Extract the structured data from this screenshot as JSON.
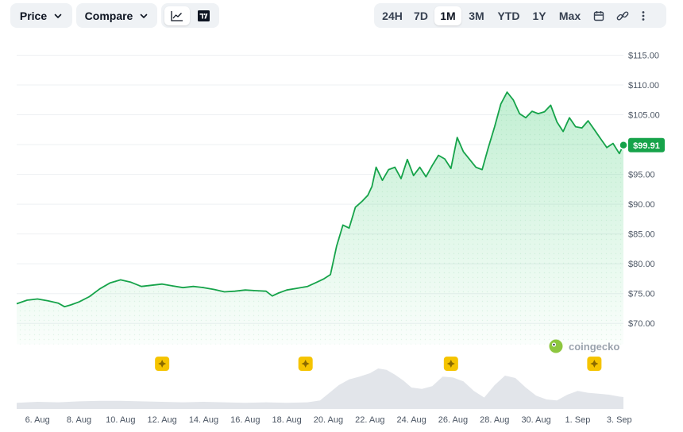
{
  "toolbar": {
    "price_label": "Price",
    "compare_label": "Compare",
    "ranges": [
      "24H",
      "7D",
      "1M",
      "3M",
      "YTD",
      "1Y",
      "Max"
    ],
    "active_range": "1M"
  },
  "watermark": "coingecko",
  "colors": {
    "line": "#16a34a",
    "area_top": "#22c55e",
    "badge": "#16a34a",
    "volume": "#e2e5ea",
    "event_marker": "#f5c400",
    "grid": "#eef0f3"
  },
  "chart_data": {
    "type": "line",
    "title": "",
    "xlabel": "",
    "ylabel": "",
    "ylim": [
      66.5,
      116
    ],
    "x_tick_labels": [
      "6. Aug",
      "8. Aug",
      "10. Aug",
      "12. Aug",
      "14. Aug",
      "16. Aug",
      "18. Aug",
      "20. Aug",
      "22. Aug",
      "24. Aug",
      "26. Aug",
      "28. Aug",
      "30. Aug",
      "1. Sep",
      "3. Sep"
    ],
    "x_tick_days": [
      6,
      8,
      10,
      12,
      14,
      16,
      18,
      20,
      22,
      24,
      26,
      28,
      30,
      32,
      34
    ],
    "y_tick_values": [
      70,
      75,
      80,
      85,
      90,
      95,
      100,
      105,
      110,
      115
    ],
    "y_tick_labels": [
      "$70.00",
      "$75.00",
      "$80.00",
      "$85.00",
      "$90.00",
      "$95.00",
      "$100.00",
      "$105.00",
      "$110.00",
      "$115.00"
    ],
    "current_price_label": "$99.91",
    "current_price": 99.91,
    "price_series": {
      "x_day": [
        5.0,
        5.5,
        6.0,
        6.5,
        7.0,
        7.3,
        7.6,
        8.0,
        8.5,
        9.0,
        9.5,
        10.0,
        10.5,
        11.0,
        11.5,
        12.0,
        12.5,
        13.0,
        13.5,
        14.0,
        14.5,
        15.0,
        15.5,
        16.0,
        16.5,
        17.0,
        17.3,
        17.6,
        18.0,
        18.5,
        19.0,
        19.5,
        19.8,
        20.1,
        20.4,
        20.7,
        21.0,
        21.3,
        21.6,
        21.9,
        22.1,
        22.3,
        22.6,
        22.9,
        23.2,
        23.5,
        23.8,
        24.1,
        24.4,
        24.7,
        25.0,
        25.3,
        25.6,
        25.9,
        26.2,
        26.5,
        26.8,
        27.1,
        27.4,
        27.7,
        28.0,
        28.3,
        28.6,
        28.9,
        29.2,
        29.5,
        29.8,
        30.1,
        30.4,
        30.7,
        31.0,
        31.3,
        31.6,
        31.9,
        32.2,
        32.5,
        32.8,
        33.1,
        33.4,
        33.7,
        34.0,
        34.2
      ],
      "price": [
        73.3,
        73.9,
        74.1,
        73.8,
        73.4,
        72.8,
        73.1,
        73.6,
        74.5,
        75.8,
        76.8,
        77.3,
        76.9,
        76.2,
        76.4,
        76.6,
        76.3,
        76.0,
        76.2,
        76.0,
        75.7,
        75.3,
        75.4,
        75.6,
        75.5,
        75.4,
        74.6,
        75.1,
        75.6,
        75.9,
        76.2,
        77.0,
        77.5,
        78.2,
        83.0,
        86.5,
        86.0,
        89.5,
        90.4,
        91.5,
        93.0,
        96.2,
        94.0,
        95.8,
        96.2,
        94.3,
        97.5,
        94.8,
        96.2,
        94.6,
        96.5,
        98.2,
        97.6,
        96.0,
        101.2,
        98.8,
        97.5,
        96.2,
        95.8,
        99.5,
        103.0,
        106.8,
        108.8,
        107.5,
        105.2,
        104.5,
        105.6,
        105.2,
        105.5,
        106.6,
        103.8,
        102.2,
        104.5,
        103.0,
        102.8,
        104.0,
        102.5,
        101.0,
        99.5,
        100.2,
        98.5,
        99.91
      ]
    },
    "volume_series": {
      "x_day": [
        5.0,
        6.0,
        7.0,
        8.0,
        9.0,
        10.0,
        11.0,
        12.0,
        13.0,
        14.0,
        15.0,
        16.0,
        17.0,
        18.0,
        19.0,
        19.6,
        20.0,
        20.5,
        21.0,
        21.5,
        22.0,
        22.4,
        22.8,
        23.2,
        23.6,
        24.0,
        24.5,
        25.0,
        25.5,
        26.0,
        26.5,
        27.0,
        27.5,
        28.0,
        28.5,
        29.0,
        29.5,
        30.0,
        30.5,
        31.0,
        31.5,
        32.0,
        32.5,
        33.0,
        33.5,
        34.0,
        34.2
      ],
      "value": [
        0.13,
        0.15,
        0.14,
        0.16,
        0.17,
        0.17,
        0.16,
        0.15,
        0.14,
        0.15,
        0.14,
        0.13,
        0.14,
        0.13,
        0.14,
        0.18,
        0.32,
        0.5,
        0.62,
        0.68,
        0.75,
        0.85,
        0.82,
        0.72,
        0.6,
        0.45,
        0.42,
        0.48,
        0.68,
        0.66,
        0.58,
        0.38,
        0.24,
        0.5,
        0.7,
        0.65,
        0.45,
        0.28,
        0.2,
        0.18,
        0.3,
        0.38,
        0.34,
        0.32,
        0.3,
        0.26,
        0.25
      ]
    },
    "event_marker_days": [
      12.0,
      18.9,
      25.9,
      32.8
    ]
  }
}
